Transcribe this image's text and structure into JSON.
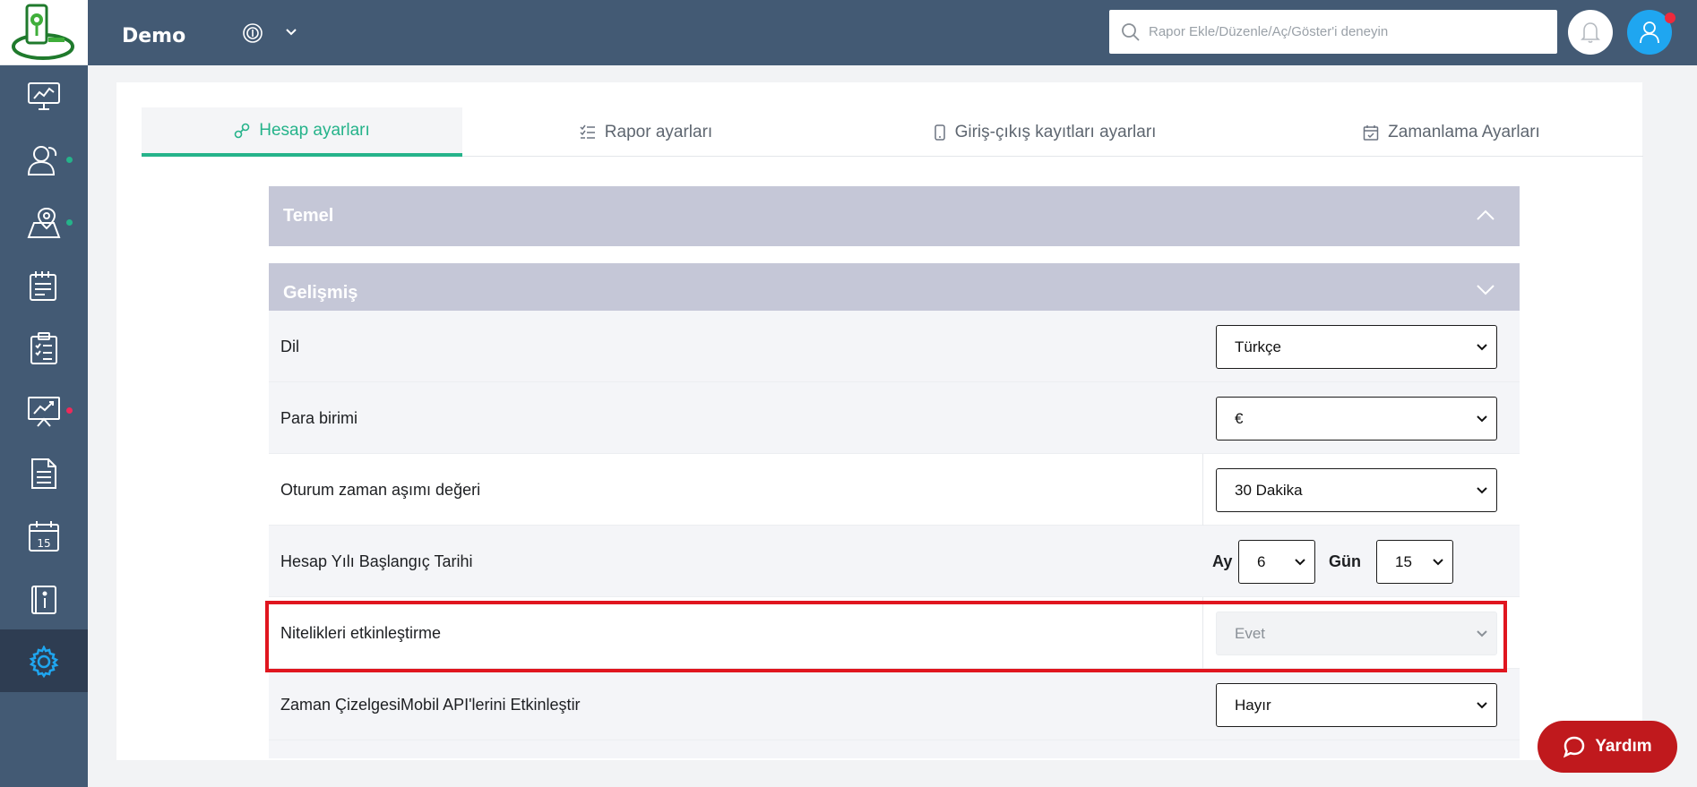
{
  "header": {
    "app_title": "Demo",
    "search_placeholder": "Rapor Ekle/Düzenle/Aç/Göster'i deneyin"
  },
  "sidebar": {
    "items": [
      {
        "name": "dashboard",
        "icon": "monitor-chart-icon",
        "dot": null,
        "active": false
      },
      {
        "name": "users",
        "icon": "users-icon",
        "dot": "#25b38a",
        "active": false
      },
      {
        "name": "locations",
        "icon": "map-pin-icon",
        "dot": "#25b38a",
        "active": false
      },
      {
        "name": "tasks",
        "icon": "notepad-icon",
        "dot": null,
        "active": false
      },
      {
        "name": "checklists",
        "icon": "clipboard-list-icon",
        "dot": null,
        "active": false
      },
      {
        "name": "reports",
        "icon": "presentation-chart-icon",
        "dot": "#ee2a5a",
        "active": false
      },
      {
        "name": "documents",
        "icon": "document-icon",
        "dot": null,
        "active": false
      },
      {
        "name": "calendar",
        "icon": "calendar-icon",
        "dot": null,
        "active": false
      },
      {
        "name": "info",
        "icon": "info-book-icon",
        "dot": null,
        "active": false
      },
      {
        "name": "settings",
        "icon": "gear-icon",
        "dot": null,
        "active": true
      }
    ]
  },
  "tabs": [
    {
      "label": "Hesap ayarları",
      "icon": "link-icon",
      "active": true
    },
    {
      "label": "Rapor ayarları",
      "icon": "checklist-icon",
      "active": false
    },
    {
      "label": "Giriş-çıkış kayıtları ayarları",
      "icon": "mobile-icon",
      "active": false
    },
    {
      "label": "Zamanlama Ayarları",
      "icon": "calendar-check-icon",
      "active": false
    }
  ],
  "panels": {
    "basic": "Temel",
    "advanced": "Gelişmiş"
  },
  "settings": {
    "language": {
      "label": "Dil",
      "value": "Türkçe"
    },
    "currency": {
      "label": "Para birimi",
      "value": "€"
    },
    "session_timeout": {
      "label": "Oturum zaman aşımı değeri",
      "value": "30 Dakika"
    },
    "fiscal_year": {
      "label": "Hesap Yılı Başlangıç Tarihi",
      "month_label": "Ay",
      "month_value": "6",
      "day_label": "Gün",
      "day_value": "15"
    },
    "attributes": {
      "label": "Nitelikleri etkinleştirme",
      "value": "Evet",
      "disabled": true,
      "highlighted": true
    },
    "timesheet_api": {
      "label": "Zaman ÇizelgesiMobil API'lerini Etkinleştir",
      "value": "Hayır"
    }
  },
  "help_button": {
    "label": "Yardım"
  },
  "colors": {
    "sidebar": "#435a74",
    "accent": "#25b38a",
    "panel_header": "#c5c7d7",
    "highlight": "#e0161f",
    "help": "#c0191d",
    "avatar": "#1fa6f0"
  }
}
